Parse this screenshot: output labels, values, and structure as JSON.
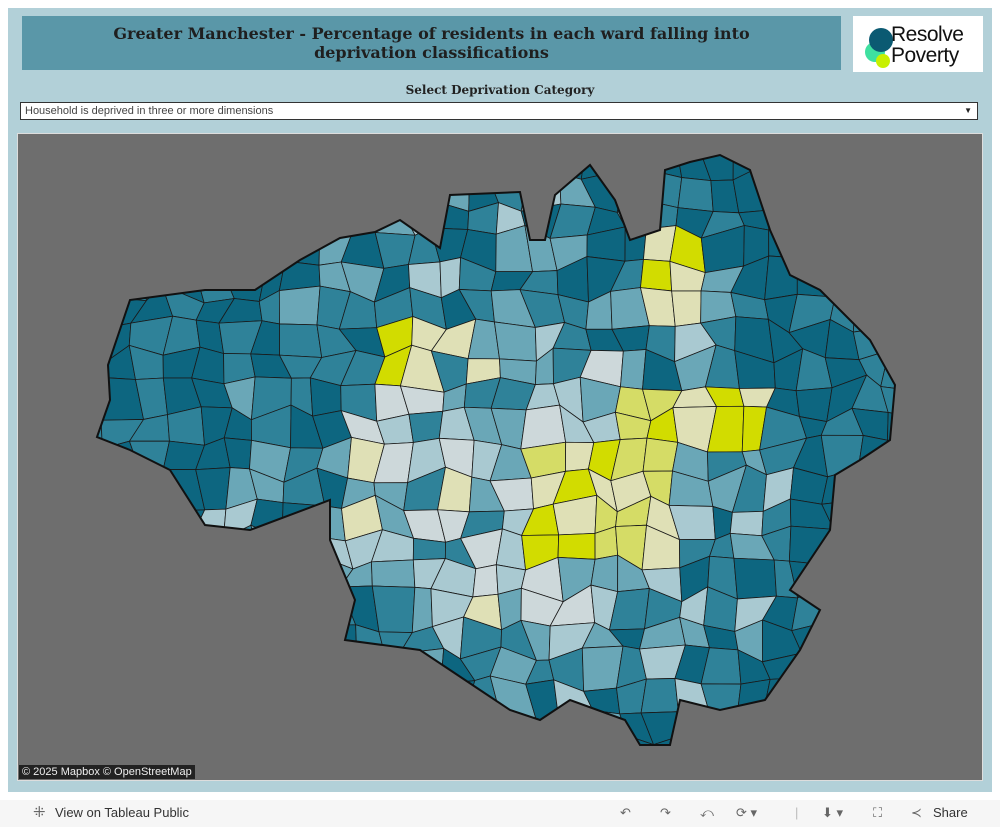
{
  "header": {
    "title": "Greater Manchester - Percentage of residents in each ward falling into deprivation classifications",
    "logo_text": [
      "Resolve",
      "Poverty"
    ]
  },
  "filter": {
    "label": "Select Deprivation Category",
    "selected": "Household is deprived in three or more dimensions"
  },
  "map": {
    "attribution": "© 2025 Mapbox © OpenStreetMap",
    "colors": {
      "high": "#0d6680",
      "midhigh": "#2f8299",
      "mid": "#6aa7b7",
      "low": "#a9c9d1",
      "lowest": "#cdd8da",
      "pale": "#dfe0b6",
      "yellow": "#d5dc66",
      "bright": "#d2dc00"
    }
  },
  "toolbar": {
    "view_label": "View on Tableau Public",
    "share_label": "Share"
  }
}
